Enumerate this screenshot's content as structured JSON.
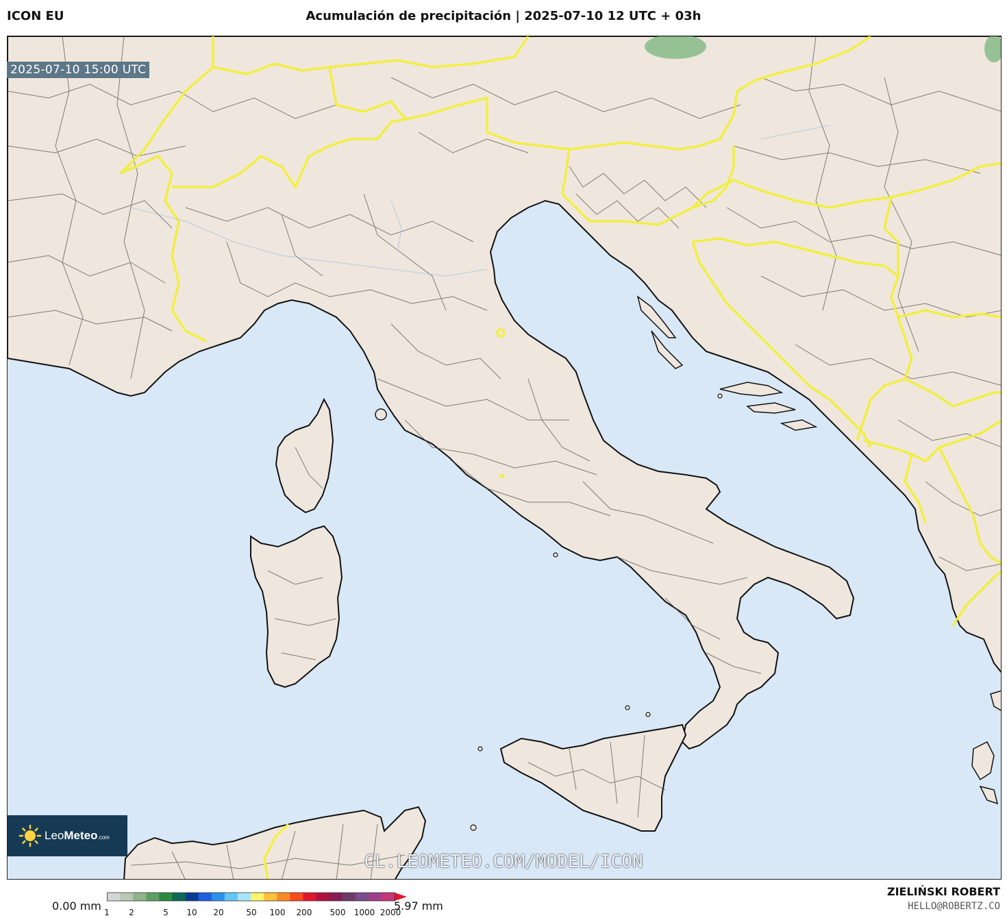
{
  "header": {
    "model": "ICON EU",
    "title": "Acumulación de precipitación | 2025-07-10 12 UTC + 03h"
  },
  "map": {
    "valid_time": "2025-07-10 15:00 UTC",
    "colors": {
      "sea": "#d9e8f7",
      "land": "#efe7dd",
      "coast": "#111111",
      "country_border": "#f2ef3a",
      "admin_border": "#555555",
      "precip_light": "#7fb883"
    },
    "watermark": "CL.LEOMETEO.COM/MODEL/ICON",
    "logo": {
      "name_light": "Leo",
      "name_bold": "Meteo",
      "suffix": ".com"
    }
  },
  "colorbar": {
    "min_label": "0.00 mm",
    "max_label": "5.97 mm",
    "ticks": [
      "1",
      "2",
      "5",
      "10",
      "20",
      "50",
      "100",
      "200",
      "500",
      "1000",
      "2000"
    ],
    "colors": [
      "#d6d6d6",
      "#b8c9b2",
      "#8fb58a",
      "#5e9e62",
      "#2b8a3e",
      "#0e6a55",
      "#0b3c94",
      "#1f5fe0",
      "#2d91f0",
      "#63c6f5",
      "#a8e4f7",
      "#fff36b",
      "#ffc23a",
      "#ff8a25",
      "#ff4a1e",
      "#e0162d",
      "#b0103d",
      "#8a1d54",
      "#6e3a6a",
      "#7a4c8a",
      "#a0408c",
      "#c63878"
    ]
  },
  "credits": {
    "author": "ZIELIŃSKI ROBERT",
    "email": "HELLO@ROBERTZ.CO"
  }
}
